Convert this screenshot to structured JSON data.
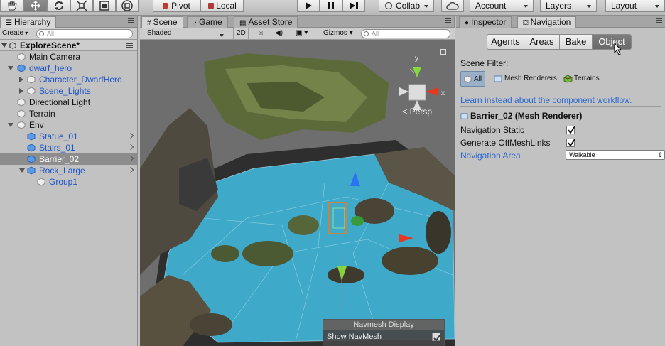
{
  "toolbar": {
    "pivot_label": "Pivot",
    "local_label": "Local",
    "collab_label": "Collab",
    "account_label": "Account",
    "layers_label": "Layers",
    "layout_label": "Layout"
  },
  "hierarchy": {
    "tab_label": "Hierarchy",
    "create_label": "Create",
    "search_placeholder": "All",
    "scene_name": "ExploreScene*",
    "items": [
      {
        "label": "Main Camera"
      },
      {
        "label": "dwarf_hero"
      },
      {
        "label": "Character_DwarfHero"
      },
      {
        "label": "Scene_Lights"
      },
      {
        "label": "Directional Light"
      },
      {
        "label": "Terrain"
      },
      {
        "label": "Env"
      },
      {
        "label": "Statue_01"
      },
      {
        "label": "Stairs_01"
      },
      {
        "label": "Barrier_02"
      },
      {
        "label": "Rock_Large"
      },
      {
        "label": "Group1"
      }
    ]
  },
  "scene": {
    "tabs": [
      {
        "label": "Scene"
      },
      {
        "label": "Game"
      },
      {
        "label": "Asset Store"
      }
    ],
    "shading_mode": "Shaded",
    "mode_2d": "2D",
    "gizmos_label": "Gizmos",
    "search_placeholder": "All",
    "persp_label": "< Persp",
    "gizmo_axis_y": "y",
    "gizmo_axis_x": "x",
    "navmesh_display": {
      "title": "Navmesh Display",
      "show_navmesh_label": "Show NavMesh",
      "show_navmesh_checked": true
    }
  },
  "navigation": {
    "tabs": [
      {
        "label": "Inspector"
      },
      {
        "label": "Navigation"
      }
    ],
    "segments": [
      {
        "label": "Agents"
      },
      {
        "label": "Areas"
      },
      {
        "label": "Bake"
      },
      {
        "label": "Object"
      }
    ],
    "active_segment": "Object",
    "scene_filter_label": "Scene Filter:",
    "filters": [
      {
        "label": "All"
      },
      {
        "label": "Mesh Renderers"
      },
      {
        "label": "Terrains"
      }
    ],
    "workflow_link": "Learn instead about the component workflow.",
    "object_title": "Barrier_02 (Mesh Renderer)",
    "navigation_static_label": "Navigation Static",
    "navigation_static": true,
    "generate_links_label": "Generate OffMeshLinks",
    "generate_links": true,
    "navigation_area_label": "Navigation Area",
    "navigation_area_value": "Walkable"
  },
  "colors": {
    "selection": "#8d8d8d",
    "prefab_text": "#1b54c8",
    "link_blue": "#2b68d0",
    "navmesh": "#3fa9c9"
  }
}
